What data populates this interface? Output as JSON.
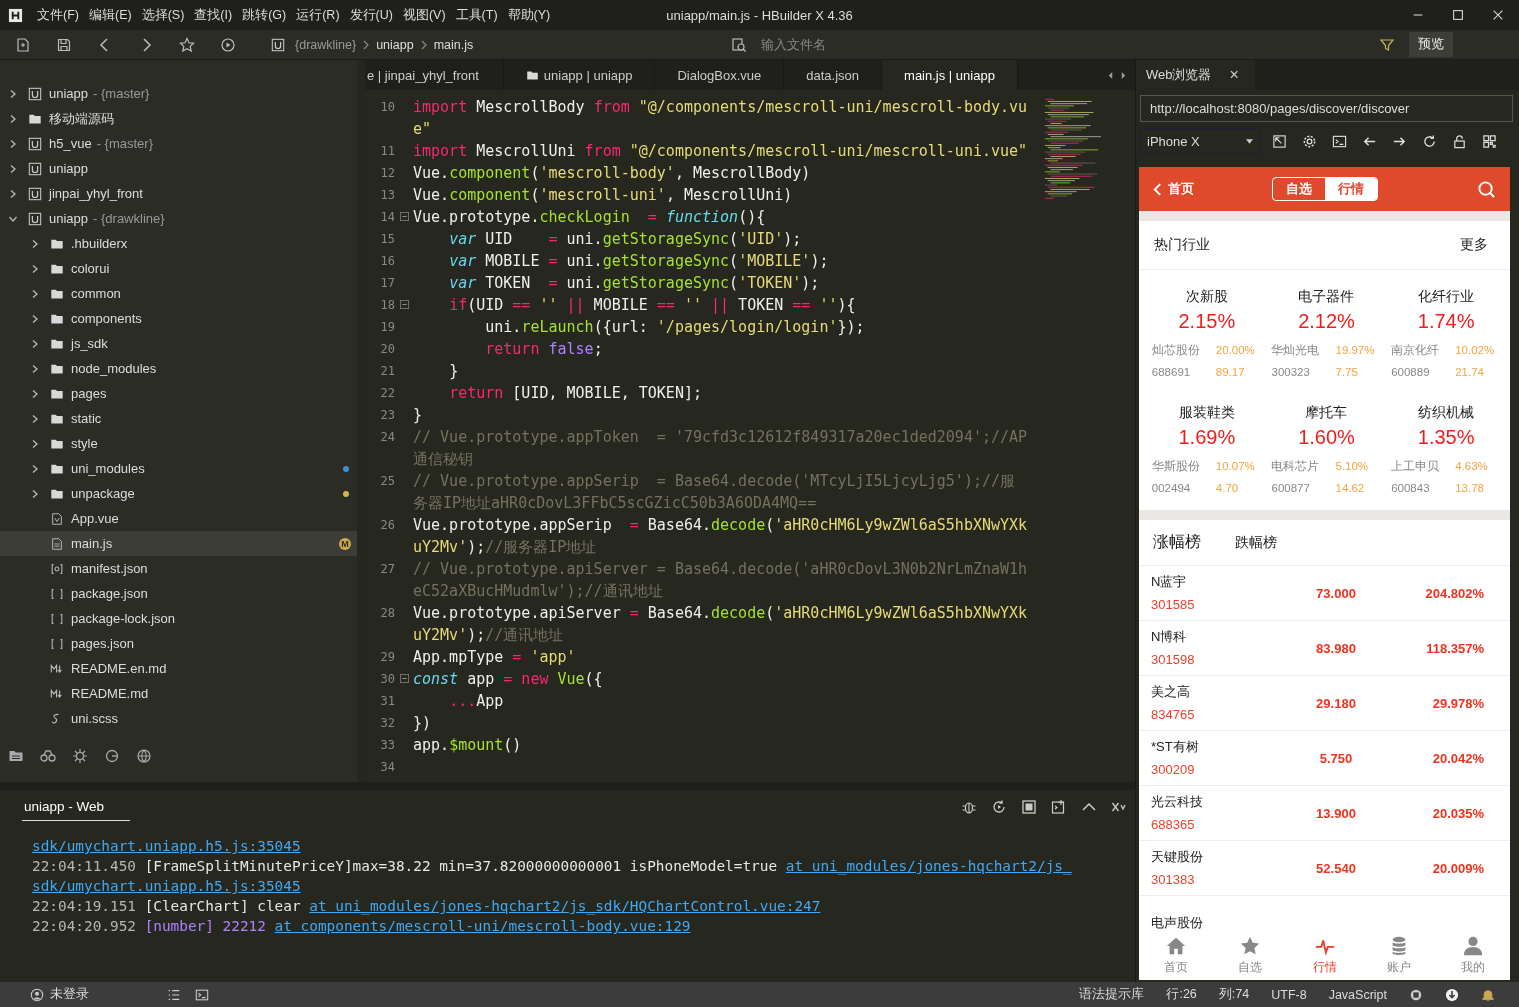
{
  "window": {
    "title": "uniapp/main.js - HBuilder X 4.36",
    "menu": [
      "文件(F)",
      "编辑(E)",
      "选择(S)",
      "查找(I)",
      "跳转(G)",
      "运行(R)",
      "发行(U)",
      "视图(V)",
      "工具(T)",
      "帮助(Y)"
    ]
  },
  "toolbar": {
    "breadcrumb": [
      "{drawkline}",
      "uniapp",
      "main.js"
    ],
    "search": {
      "placeholder": "输入文件名"
    },
    "preview_button": "预览"
  },
  "project_tree": [
    {
      "label": "uniapp",
      "suffix": "- {master}",
      "kind": "project",
      "expanded": false,
      "selected": false
    },
    {
      "label": "移动端源码",
      "kind": "folder",
      "expanded": false,
      "selected": false
    },
    {
      "label": "h5_vue",
      "suffix": "- {master}",
      "kind": "project",
      "expanded": false,
      "selected": false
    },
    {
      "label": "uniapp",
      "kind": "project",
      "expanded": false,
      "selected": false
    },
    {
      "label": "jinpai_yhyl_front",
      "kind": "project",
      "expanded": false,
      "selected": false
    },
    {
      "label": "uniapp",
      "suffix": "- {drawkline}",
      "kind": "project",
      "expanded": true,
      "selected": false,
      "children": [
        {
          "label": ".hbuilderx",
          "kind": "folder",
          "expanded": false,
          "selected": false
        },
        {
          "label": "colorui",
          "kind": "folder",
          "expanded": false,
          "selected": false
        },
        {
          "label": "common",
          "kind": "folder",
          "expanded": false,
          "selected": false
        },
        {
          "label": "components",
          "kind": "folder",
          "expanded": false,
          "selected": false
        },
        {
          "label": "js_sdk",
          "kind": "folder",
          "expanded": false,
          "selected": false
        },
        {
          "label": "node_modules",
          "kind": "folder",
          "expanded": false,
          "selected": false
        },
        {
          "label": "pages",
          "kind": "folder",
          "expanded": false,
          "selected": false
        },
        {
          "label": "static",
          "kind": "folder",
          "expanded": false,
          "selected": false
        },
        {
          "label": "style",
          "kind": "folder",
          "expanded": false,
          "selected": false
        },
        {
          "label": "uni_modules",
          "kind": "folder",
          "expanded": false,
          "selected": false,
          "color": "#3d8fd1"
        },
        {
          "label": "unpackage",
          "kind": "folder",
          "expanded": false,
          "selected": false,
          "color": "#d4b44a"
        },
        {
          "label": "App.vue",
          "kind": "vue",
          "selected": false
        },
        {
          "label": "main.js",
          "kind": "js",
          "selected": true,
          "badge": "M"
        },
        {
          "label": "manifest.json",
          "kind": "manifest",
          "selected": false
        },
        {
          "label": "package.json",
          "kind": "json",
          "selected": false
        },
        {
          "label": "package-lock.json",
          "kind": "json",
          "selected": false
        },
        {
          "label": "pages.json",
          "kind": "json",
          "selected": false
        },
        {
          "label": "README.en.md",
          "kind": "md",
          "selected": false
        },
        {
          "label": "README.md",
          "kind": "md",
          "selected": false
        },
        {
          "label": "uni.scss",
          "kind": "scss",
          "selected": false
        }
      ]
    }
  ],
  "editor_tabs": [
    {
      "label": "e | jinpai_yhyl_front",
      "kind": "file",
      "selected": false
    },
    {
      "label": "uniapp | uniapp",
      "kind": "folder",
      "selected": false
    },
    {
      "label": "DialogBox.vue",
      "kind": "file",
      "selected": false
    },
    {
      "label": "data.json",
      "kind": "file",
      "selected": false
    },
    {
      "label": "main.js | uniapp",
      "kind": "file",
      "selected": true
    }
  ],
  "code_lines": [
    {
      "n": "10",
      "t": [
        {
          "kind": "keyword",
          "text": "import"
        },
        {
          "kind": "plain",
          "text": " MescrollBody "
        },
        {
          "kind": "keyword",
          "text": "from "
        },
        {
          "kind": "string",
          "text": "\"@/components/mescroll-uni/mescroll-body.vue\""
        }
      ]
    },
    {
      "n": "11",
      "t": [
        {
          "kind": "keyword",
          "text": "import"
        },
        {
          "kind": "plain",
          "text": " MescrollUni "
        },
        {
          "kind": "keyword",
          "text": "from "
        },
        {
          "kind": "string",
          "text": "\"@/components/mescroll-uni/mescroll-uni.vue\""
        }
      ]
    },
    {
      "n": "12",
      "t": [
        {
          "kind": "plain",
          "text": "Vue."
        },
        {
          "kind": "call",
          "text": "component"
        },
        {
          "kind": "plain",
          "text": "("
        },
        {
          "kind": "string",
          "text": "'mescroll-body'"
        },
        {
          "kind": "plain",
          "text": ", MescrollBody)"
        }
      ]
    },
    {
      "n": "13",
      "t": [
        {
          "kind": "plain",
          "text": "Vue."
        },
        {
          "kind": "call",
          "text": "component"
        },
        {
          "kind": "plain",
          "text": "("
        },
        {
          "kind": "string",
          "text": "'mescroll-uni'"
        },
        {
          "kind": "plain",
          "text": ", MescrollUni)"
        }
      ]
    },
    {
      "n": "14",
      "fold": true,
      "t": [
        {
          "kind": "plain",
          "text": "Vue.prototype."
        },
        {
          "kind": "call",
          "text": "checkLogin  "
        },
        {
          "kind": "keyword",
          "text": "= "
        },
        {
          "kind": "storage",
          "text": "function"
        },
        {
          "kind": "plain",
          "text": "(){"
        }
      ]
    },
    {
      "n": "15",
      "t": [
        {
          "kind": "storage",
          "text": "    var"
        },
        {
          "kind": "plain",
          "text": " UID    "
        },
        {
          "kind": "keyword",
          "text": "="
        },
        {
          "kind": "plain",
          "text": " uni."
        },
        {
          "kind": "call",
          "text": "getStorageSync"
        },
        {
          "kind": "plain",
          "text": "("
        },
        {
          "kind": "string",
          "text": "'UID'"
        },
        {
          "kind": "plain",
          "text": ");"
        }
      ]
    },
    {
      "n": "16",
      "t": [
        {
          "kind": "storage",
          "text": "    var"
        },
        {
          "kind": "plain",
          "text": " MOBILE "
        },
        {
          "kind": "keyword",
          "text": "="
        },
        {
          "kind": "plain",
          "text": " uni."
        },
        {
          "kind": "call",
          "text": "getStorageSync"
        },
        {
          "kind": "plain",
          "text": "("
        },
        {
          "kind": "string",
          "text": "'MOBILE'"
        },
        {
          "kind": "plain",
          "text": ");"
        }
      ]
    },
    {
      "n": "17",
      "t": [
        {
          "kind": "storage",
          "text": "    var"
        },
        {
          "kind": "plain",
          "text": " TOKEN  "
        },
        {
          "kind": "keyword",
          "text": "="
        },
        {
          "kind": "plain",
          "text": " uni."
        },
        {
          "kind": "call",
          "text": "getStorageSync"
        },
        {
          "kind": "plain",
          "text": "("
        },
        {
          "kind": "string",
          "text": "'TOKEN'"
        },
        {
          "kind": "plain",
          "text": ");"
        }
      ]
    },
    {
      "n": "18",
      "fold": true,
      "t": [
        {
          "kind": "keyword",
          "text": "    if"
        },
        {
          "kind": "plain",
          "text": "(UID "
        },
        {
          "kind": "keyword",
          "text": "== "
        },
        {
          "kind": "string",
          "text": "'' "
        },
        {
          "kind": "keyword",
          "text": "||"
        },
        {
          "kind": "plain",
          "text": " MOBILE "
        },
        {
          "kind": "keyword",
          "text": "== "
        },
        {
          "kind": "string",
          "text": "'' "
        },
        {
          "kind": "keyword",
          "text": "||"
        },
        {
          "kind": "plain",
          "text": " TOKEN "
        },
        {
          "kind": "keyword",
          "text": "== "
        },
        {
          "kind": "string",
          "text": "''"
        },
        {
          "kind": "plain",
          "text": "){"
        }
      ]
    },
    {
      "n": "19",
      "t": [
        {
          "kind": "plain",
          "text": "        uni."
        },
        {
          "kind": "call",
          "text": "reLaunch"
        },
        {
          "kind": "plain",
          "text": "({url: "
        },
        {
          "kind": "string",
          "text": "'/pages/login/login'"
        },
        {
          "kind": "plain",
          "text": "});"
        }
      ]
    },
    {
      "n": "20",
      "t": [
        {
          "kind": "keyword",
          "text": "        return "
        },
        {
          "kind": "constant",
          "text": "false"
        },
        {
          "kind": "plain",
          "text": ";"
        }
      ]
    },
    {
      "n": "21",
      "t": [
        {
          "kind": "plain",
          "text": "    }"
        }
      ]
    },
    {
      "n": "22",
      "t": [
        {
          "kind": "keyword",
          "text": "    return"
        },
        {
          "kind": "plain",
          "text": " [UID, MOBILE, TOKEN];"
        }
      ]
    },
    {
      "n": "23",
      "t": [
        {
          "kind": "plain",
          "text": "}"
        }
      ]
    },
    {
      "n": "24",
      "t": [
        {
          "kind": "comment",
          "text": "// Vue.prototype.appToken  = '79cfd3c12612f849317a20ec1ded2094';//AP通信秘钥"
        }
      ]
    },
    {
      "n": "25",
      "t": [
        {
          "kind": "comment",
          "text": "// Vue.prototype.appSerip  = Base64.decode('MTcyLjI5LjcyLjg5');//服务器IP地址aHR0cDovL3FFbC5scGZicC50b3A6ODA4MQ=="
        }
      ]
    },
    {
      "n": "26",
      "t": [
        {
          "kind": "plain",
          "text": "Vue.prototype.appSerip  "
        },
        {
          "kind": "keyword",
          "text": "="
        },
        {
          "kind": "plain",
          "text": " Base64."
        },
        {
          "kind": "call",
          "text": "decode"
        },
        {
          "kind": "plain",
          "text": "("
        },
        {
          "kind": "string",
          "text": "'aHR0cHM6Ly9wZWl6aS5hbXNwYXkuY2Mv'"
        },
        {
          "kind": "plain",
          "text": ");"
        },
        {
          "kind": "comment",
          "text": "//服务器IP地址"
        }
      ]
    },
    {
      "n": "27",
      "t": [
        {
          "kind": "comment",
          "text": "// Vue.prototype.apiServer = Base64.decode('aHR0cDovL3N0b2NrLmZnaW1heC52aXBucHMudmlw');//通讯地址"
        }
      ]
    },
    {
      "n": "28",
      "t": [
        {
          "kind": "plain",
          "text": "Vue.prototype.apiServer "
        },
        {
          "kind": "keyword",
          "text": "="
        },
        {
          "kind": "plain",
          "text": " Base64."
        },
        {
          "kind": "call",
          "text": "decode"
        },
        {
          "kind": "plain",
          "text": "("
        },
        {
          "kind": "string",
          "text": "'aHR0cHM6Ly9wZWl6aS5hbXNwYXkuY2Mv'"
        },
        {
          "kind": "plain",
          "text": ");"
        },
        {
          "kind": "comment",
          "text": "//通讯地址"
        }
      ]
    },
    {
      "n": "29",
      "t": [
        {
          "kind": "plain",
          "text": "App.mpType "
        },
        {
          "kind": "keyword",
          "text": "= "
        },
        {
          "kind": "string",
          "text": "'app'"
        }
      ]
    },
    {
      "n": "30",
      "fold": true,
      "t": [
        {
          "kind": "storage",
          "text": "const"
        },
        {
          "kind": "plain",
          "text": " app "
        },
        {
          "kind": "keyword",
          "text": "= new "
        },
        {
          "kind": "call",
          "text": "Vue"
        },
        {
          "kind": "plain",
          "text": "({"
        }
      ]
    },
    {
      "n": "31",
      "t": [
        {
          "kind": "keyword",
          "text": "    ..."
        },
        {
          "kind": "plain",
          "text": "App"
        }
      ]
    },
    {
      "n": "32",
      "t": [
        {
          "kind": "plain",
          "text": "})"
        }
      ]
    },
    {
      "n": "33",
      "t": [
        {
          "kind": "plain",
          "text": "app."
        },
        {
          "kind": "call",
          "text": "$mount"
        },
        {
          "kind": "plain",
          "text": "()"
        }
      ]
    },
    {
      "n": "34"
    }
  ],
  "console": {
    "tab": "uniapp - Web",
    "lines": [
      [
        {
          "kind": "link",
          "text": "sdk/umychart.uniapp.h5.js:35045"
        }
      ],
      [
        {
          "kind": "time",
          "text": "22:04:11.450"
        },
        {
          "kind": "plain",
          "text": " [FrameSplitMinutePriceY]max=38.22 min=37.82000000000001 isPhoneModel=true "
        },
        {
          "kind": "link",
          "text": "at uni_modules/jones-hqchart2/js_"
        }
      ],
      [
        {
          "kind": "link",
          "text": "sdk/umychart.uniapp.h5.js:35045"
        }
      ],
      [
        {
          "kind": "time",
          "text": "22:04:19.151"
        },
        {
          "kind": "plain",
          "text": " [ClearChart] clear "
        },
        {
          "kind": "link",
          "text": "at uni_modules/jones-hqchart2/js_sdk/HQChartControl.vue:247"
        }
      ],
      [
        {
          "kind": "time",
          "text": "22:04:20.952"
        },
        {
          "kind": "number",
          "text": " [number] 22212 "
        },
        {
          "kind": "link",
          "text": "at components/mescroll-uni/mescroll-body.vue:129"
        }
      ]
    ]
  },
  "browser": {
    "tab": "Web浏览器",
    "close": "×",
    "url": "http://localhost:8080/pages/discover/discover",
    "device": "iPhone X"
  },
  "mobile": {
    "back": "首页",
    "segments": [
      {
        "label": "自选",
        "selected": false
      },
      {
        "label": "行情",
        "selected": true
      }
    ],
    "hot_title": "热门行业",
    "more": "更多",
    "industries": [
      {
        "name": "次新股",
        "pct": "2.15%",
        "stock": "灿芯股份",
        "stock_pct": "20.00%",
        "code": "688691",
        "price": "89.17"
      },
      {
        "name": "电子器件",
        "pct": "2.12%",
        "stock": "华灿光电",
        "stock_pct": "19.97%",
        "code": "300323",
        "price": "7.75"
      },
      {
        "name": "化纤行业",
        "pct": "1.74%",
        "stock": "南京化纤",
        "stock_pct": "10.02%",
        "code": "600889",
        "price": "21.74"
      },
      {
        "name": "服装鞋类",
        "pct": "1.69%",
        "stock": "华斯股份",
        "stock_pct": "10.07%",
        "code": "002494",
        "price": "4.70"
      },
      {
        "name": "摩托车",
        "pct": "1.60%",
        "stock": "电科芯片",
        "stock_pct": "5.10%",
        "code": "600877",
        "price": "14.62"
      },
      {
        "name": "纺织机械",
        "pct": "1.35%",
        "stock": "上工申贝",
        "stock_pct": "4.63%",
        "code": "600843",
        "price": "13.78"
      }
    ],
    "rank_tabs": [
      {
        "label": "涨幅榜",
        "selected": true
      },
      {
        "label": "跌幅榜",
        "selected": false
      }
    ],
    "rows": [
      {
        "name": "N蓝宇",
        "code": "301585",
        "price": "73.000",
        "pct": "204.802%"
      },
      {
        "name": "N博科",
        "code": "301598",
        "price": "83.980",
        "pct": "118.357%"
      },
      {
        "name": "美之高",
        "code": "834765",
        "price": "29.180",
        "pct": "29.978%"
      },
      {
        "name": "*ST有树",
        "code": "300209",
        "price": "5.750",
        "pct": "20.042%"
      },
      {
        "name": "光云科技",
        "code": "688365",
        "price": "13.900",
        "pct": "20.035%"
      },
      {
        "name": "天键股份",
        "code": "301383",
        "price": "52.540",
        "pct": "20.009%"
      },
      {
        "name": "电声股份"
      }
    ],
    "tabbar": [
      {
        "label": "首页",
        "kind": "home",
        "selected": false
      },
      {
        "label": "自选",
        "kind": "star",
        "selected": false
      },
      {
        "label": "行情",
        "kind": "pulse",
        "selected": true
      },
      {
        "label": "账户",
        "kind": "coins",
        "selected": false
      },
      {
        "label": "我的",
        "kind": "person",
        "selected": false
      }
    ]
  },
  "status_bar": {
    "login": "未登录",
    "right": [
      "语法提示库",
      "行:26",
      "列:74",
      "UTF-8",
      "JavaScript"
    ]
  }
}
